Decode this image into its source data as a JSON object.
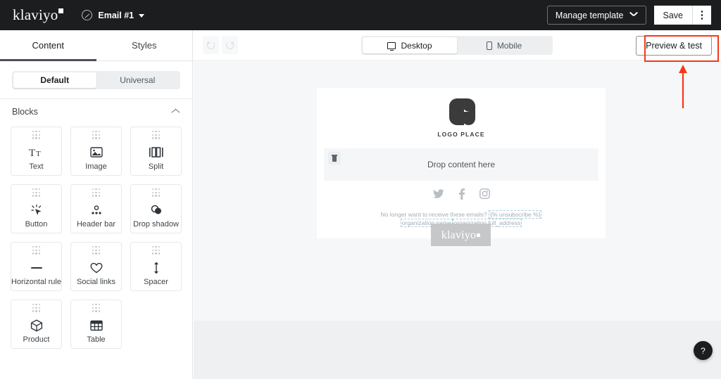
{
  "topbar": {
    "brand": "klaviyo",
    "doc_icon": "compass-icon",
    "doc_name": "Email #1",
    "manage_template_label": "Manage template",
    "save_label": "Save",
    "kebab_icon": "more-vertical-icon"
  },
  "sidebar": {
    "tabs": [
      {
        "label": "Content",
        "active": true
      },
      {
        "label": "Styles",
        "active": false
      }
    ],
    "segment": [
      {
        "label": "Default",
        "active": true
      },
      {
        "label": "Universal",
        "active": false
      }
    ],
    "section": {
      "title": "Blocks",
      "chevron": "chevron-up-icon"
    },
    "blocks": [
      {
        "label": "Text",
        "icon": "text-icon"
      },
      {
        "label": "Image",
        "icon": "image-icon"
      },
      {
        "label": "Split",
        "icon": "split-icon"
      },
      {
        "label": "Button",
        "icon": "button-click-icon"
      },
      {
        "label": "Header bar",
        "icon": "header-bar-icon"
      },
      {
        "label": "Drop shadow",
        "icon": "drop-shadow-icon"
      },
      {
        "label": "Horizontal rule",
        "icon": "horizontal-rule-icon"
      },
      {
        "label": "Social links",
        "icon": "heart-icon"
      },
      {
        "label": "Spacer",
        "icon": "vertical-arrows-icon"
      },
      {
        "label": "Product",
        "icon": "cube-icon"
      },
      {
        "label": "Table",
        "icon": "table-icon"
      }
    ]
  },
  "toolbar": {
    "undo_icon": "undo-icon",
    "redo_icon": "redo-icon",
    "devices": [
      {
        "label": "Desktop",
        "icon": "monitor-icon",
        "active": true
      },
      {
        "label": "Mobile",
        "icon": "phone-icon",
        "active": false
      }
    ],
    "preview_label": "Preview & test"
  },
  "canvas": {
    "logo_text": "LOGO PLACE",
    "dropzone_text": "Drop content here",
    "dropzone_trash_icon": "trash-icon",
    "social": [
      {
        "icon": "twitter-icon"
      },
      {
        "icon": "facebook-icon"
      },
      {
        "icon": "instagram-icon"
      }
    ],
    "footer_prefix": "No longer want to receive these emails?",
    "footer_unsubscribe_tag": "{% unsubscribe %}",
    "footer_org_name_tag": "organization.name",
    "footer_org_address_tag": "organization.full_address",
    "klaviyo_badge": "klaviyo"
  },
  "help": {
    "label": "?"
  },
  "annotation": {
    "accent_color": "#f4381a",
    "target": "Preview & test"
  }
}
